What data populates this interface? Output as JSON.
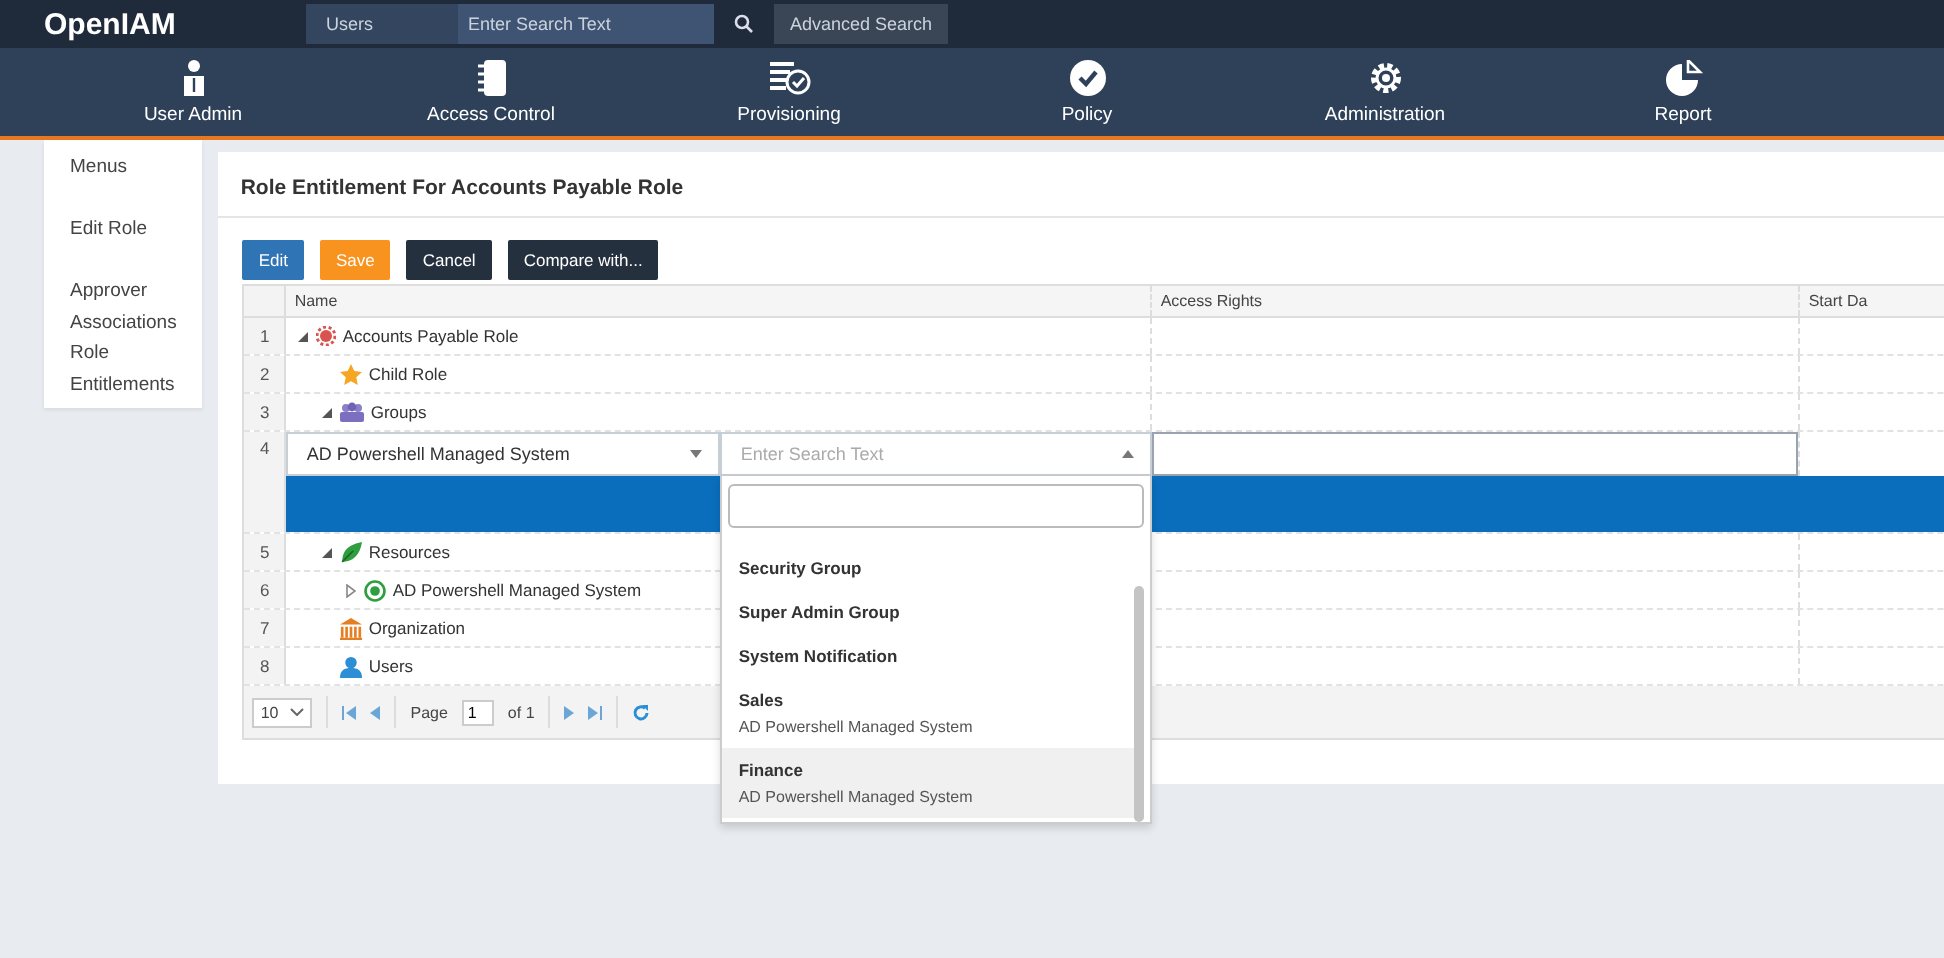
{
  "header": {
    "logo": "OpenIAM",
    "search_scope": "Users",
    "search_placeholder": "Enter Search Text",
    "advanced_search": "Advanced Search"
  },
  "nav": [
    "User Admin",
    "Access Control",
    "Provisioning",
    "Policy",
    "Administration",
    "Report"
  ],
  "sidebar": {
    "items": [
      "Menus",
      "Edit Role",
      "Approver Associations",
      "Role Entitlements"
    ]
  },
  "page": {
    "title": "Role Entitlement For Accounts Payable Role",
    "buttons": [
      {
        "label": "Edit",
        "kind": "primary"
      },
      {
        "label": "Save",
        "kind": "warning"
      },
      {
        "label": "Cancel",
        "kind": "dark"
      },
      {
        "label": "Compare with...",
        "kind": "dark"
      }
    ]
  },
  "grid": {
    "columns": [
      "Name",
      "Access Rights",
      "Start Da"
    ],
    "rows": [
      {
        "kind": "role",
        "number": "1",
        "label": "Accounts Payable Role",
        "expanded": true,
        "children": [
          {
            "kind": "childrole",
            "number": "2",
            "label": "Child Role"
          },
          {
            "kind": "groups",
            "number": "3",
            "label": "Groups",
            "expanded": true,
            "children": [
              {
                "kind": "editor",
                "number": "4",
                "selected": true,
                "value": "AD Powershell Managed System",
                "search_placeholder": "Enter Search Text",
                "options": [
                  {
                    "title": "Security Group",
                    "highlighted": false
                  },
                  {
                    "title": "Super Admin Group",
                    "highlighted": false
                  },
                  {
                    "title": "System Notification",
                    "highlighted": false
                  },
                  {
                    "title": "Sales",
                    "subtitle": "AD Powershell Managed System",
                    "highlighted": false
                  },
                  {
                    "title": "Finance",
                    "subtitle": "AD Powershell Managed System",
                    "highlighted": true
                  }
                ]
              }
            ]
          },
          {
            "kind": "resources",
            "number": "5",
            "label": "Resources",
            "expanded": true,
            "children": [
              {
                "kind": "system",
                "number": "6",
                "label": "AD Powershell Managed System",
                "expanded": false
              }
            ]
          },
          {
            "kind": "organization",
            "number": "7",
            "label": "Organization"
          },
          {
            "kind": "users",
            "number": "8",
            "label": "Users"
          }
        ]
      }
    ]
  },
  "pager": {
    "page_size": "10",
    "page_label": "Page",
    "page": "1",
    "page_total": "of 1"
  }
}
